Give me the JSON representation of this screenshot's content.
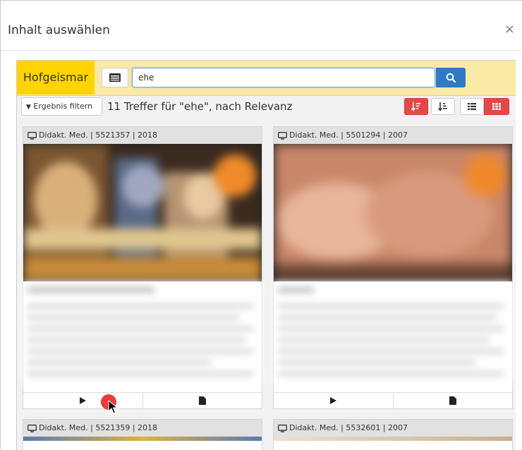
{
  "modal": {
    "title": "Inhalt auswählen",
    "close_label": "×"
  },
  "search": {
    "brand": "Hofgeismar",
    "query": "ehe",
    "list_icon": "list-icon",
    "search_icon": "search-icon"
  },
  "toolbar": {
    "filter_label": "Ergebnis filtern",
    "filter_icon": "filter-icon",
    "result_text": "11 Treffer für \"ehe\", nach Relevanz",
    "sort_relevance_icon": "sort-relevance-icon",
    "sort_date_icon": "sort-date-icon",
    "list_view_icon": "list-view-icon",
    "grid_view_icon": "grid-view-icon"
  },
  "cards": [
    {
      "header": "Didakt. Med. | 5521357 | 2018",
      "play_icon": "play-icon",
      "doc_icon": "document-icon"
    },
    {
      "header": "Didakt. Med. | 5501294 | 2007",
      "play_icon": "play-icon",
      "doc_icon": "document-icon"
    },
    {
      "header": "Didakt. Med. | 5521359 | 2018"
    },
    {
      "header": "Didakt. Med. | 5532601 | 2007"
    }
  ],
  "colors": {
    "brand_yellow": "#ffd400",
    "bar_yellow": "#fbe9a6",
    "primary_blue": "#2f7ac4",
    "active_red": "#e24a4a"
  }
}
